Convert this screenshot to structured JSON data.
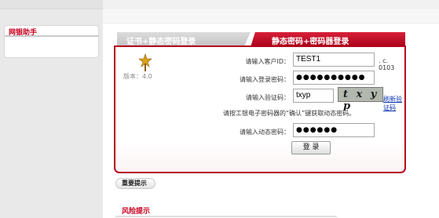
{
  "sidebar": {
    "panel_title": "网银助手"
  },
  "tabs": [
    {
      "label": "证书+静态密码登录",
      "active": false
    },
    {
      "label": "静态密码+密码器登录",
      "active": true
    }
  ],
  "login_form": {
    "version_text": "版本：4.0",
    "customer_id_label": "请输入客户ID：",
    "customer_id_value": "TEST1",
    "customer_id_suffix": ". c. 0103",
    "password_label": "请输入登录密码：",
    "password_value": "●●●●●●●●●●",
    "captcha_label": "请输入验证码：",
    "captcha_input_value": "txyp",
    "captcha_image_text": "t x y p",
    "refresh_link": "刷新验证码",
    "hint": "请按工银电子密码器的“确认”键获取动态密码。",
    "dynamic_password_label": "请输入动态密码：",
    "dynamic_password_value": "●●●●●●",
    "login_button": "登 录"
  },
  "bottom": {
    "notice_button": "重要提示",
    "risk_title": "风险提示"
  },
  "colors": {
    "brand_red": "#b5001b",
    "link_blue": "#0b35b2"
  }
}
